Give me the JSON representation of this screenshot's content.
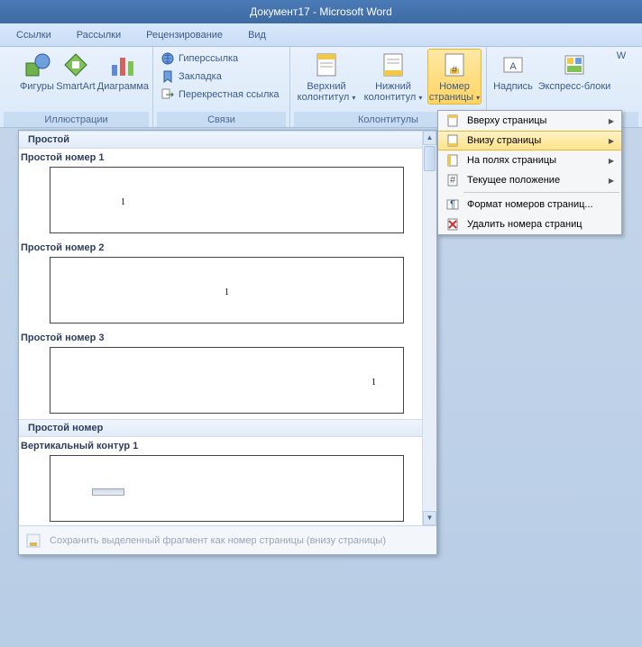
{
  "title": "Документ17 - Microsoft Word",
  "tabs": [
    "Ссылки",
    "Рассылки",
    "Рецензирование",
    "Вид"
  ],
  "ribbon": {
    "illustrations": {
      "label": "Иллюстрации",
      "shapes": "Фигуры",
      "smartart": "SmartArt",
      "chart": "Диаграмма"
    },
    "links": {
      "label": "Связи",
      "hyperlink": "Гиперссылка",
      "bookmark": "Закладка",
      "crossref": "Перекрестная ссылка"
    },
    "headerfooter": {
      "label": "Колонтитулы",
      "header": "Верхний колонтитул",
      "footer": "Нижний колонтитул",
      "pagenum": "Номер страницы"
    },
    "text": {
      "textbox": "Надпись",
      "quickparts": "Экспресс-блоки",
      "wordart": "W"
    }
  },
  "dropdown": {
    "top": "Вверху страницы",
    "bottom": "Внизу страницы",
    "margins": "На полях страницы",
    "current": "Текущее положение",
    "format": "Формат номеров страниц...",
    "remove": "Удалить номера страниц"
  },
  "gallery": {
    "cat1": "Простой",
    "item1": "Простой номер 1",
    "item2": "Простой номер 2",
    "item3": "Простой номер 3",
    "cat2": "Простой номер",
    "item4": "Вертикальный контур 1",
    "save": "Сохранить выделенный фрагмент как номер страницы (внизу страницы)"
  }
}
